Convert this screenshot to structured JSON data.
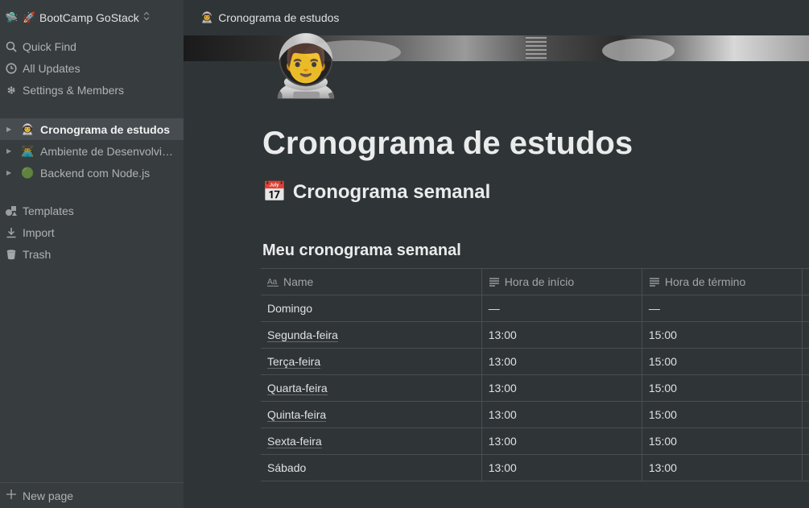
{
  "sidebar": {
    "workspace": {
      "icon": "🛸",
      "rocket": "🚀",
      "name": "BootCamp GoStack",
      "chevron": "⌃"
    },
    "nav": [
      {
        "label": "Quick Find",
        "icon": "search-icon"
      },
      {
        "label": "All Updates",
        "icon": "clock-icon"
      },
      {
        "label": "Settings & Members",
        "icon": "gear-icon"
      }
    ],
    "pages": [
      {
        "emoji": "👨‍🚀",
        "label": "Cronograma de estudos",
        "active": true
      },
      {
        "emoji": "👨‍💻",
        "label": "Ambiente de Desenvolvimento",
        "active": false
      },
      {
        "emoji": "🟢",
        "label": "Backend com Node.js",
        "active": false
      }
    ],
    "tools": [
      {
        "label": "Templates",
        "icon": "shapes-icon"
      },
      {
        "label": "Import",
        "icon": "download-icon"
      },
      {
        "label": "Trash",
        "icon": "trash-icon"
      }
    ],
    "new_page": "New page"
  },
  "topbar": {
    "emoji": "👨‍🚀",
    "title": "Cronograma de estudos"
  },
  "page": {
    "icon": "👨‍🚀",
    "title": "Cronograma de estudos",
    "heading1_emoji": "📅",
    "heading1": "Cronograma semanal",
    "heading3": "Meu cronograma semanal"
  },
  "table": {
    "columns": [
      {
        "label": "Name",
        "icon": "text-title-icon"
      },
      {
        "label": "Hora de início",
        "icon": "text-lines-icon"
      },
      {
        "label": "Hora de término",
        "icon": "text-lines-icon"
      }
    ],
    "rows": [
      {
        "name": "Domingo",
        "start": "—",
        "end": "—"
      },
      {
        "name": "Segunda-feira",
        "start": "13:00",
        "end": "15:00"
      },
      {
        "name": "Terça-feira",
        "start": "13:00",
        "end": "15:00"
      },
      {
        "name": "Quarta-feira",
        "start": "13:00",
        "end": "15:00"
      },
      {
        "name": "Quinta-feira",
        "start": "13:00",
        "end": "15:00"
      },
      {
        "name": "Sexta-feira",
        "start": "13:00",
        "end": "15:00"
      },
      {
        "name": "Sábado",
        "start": "13:00",
        "end": "13:00"
      }
    ]
  },
  "colors": {
    "background": "#2f3437",
    "sidebar": "#373c3f",
    "active_item": "#474c50"
  }
}
